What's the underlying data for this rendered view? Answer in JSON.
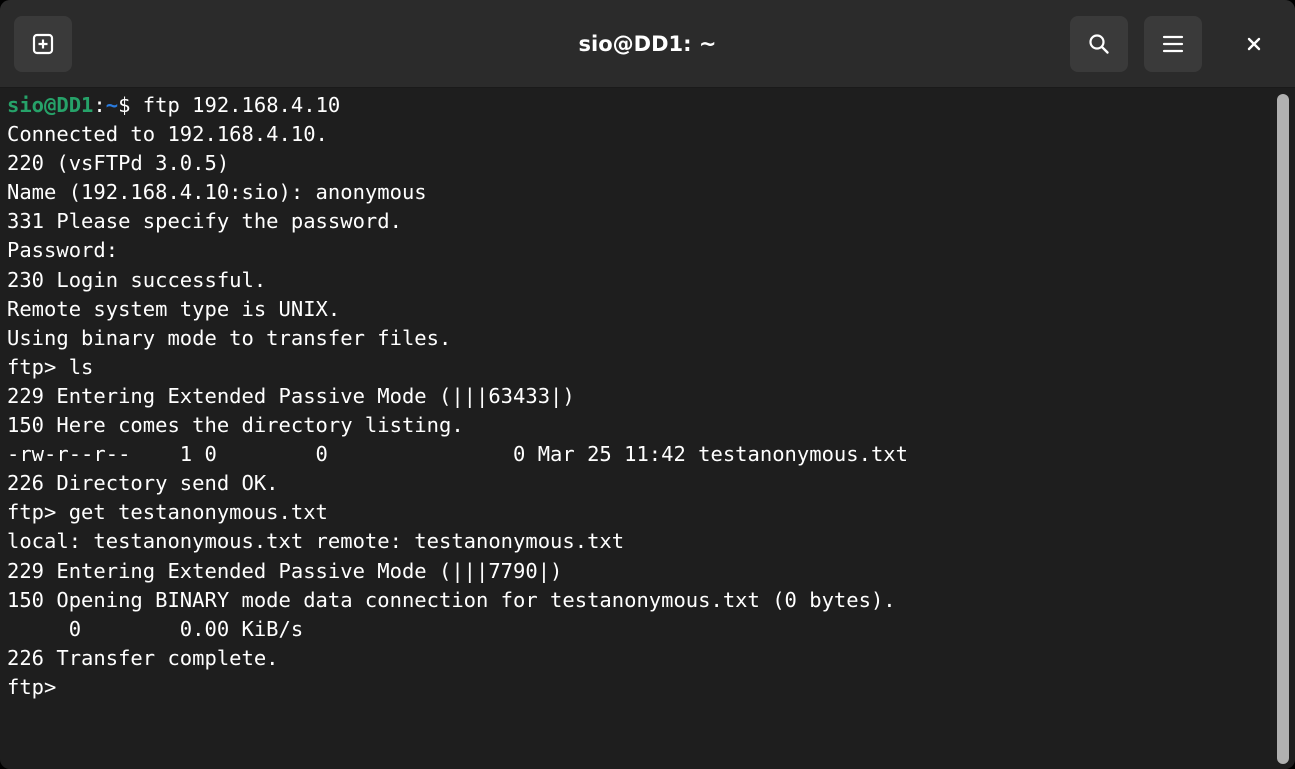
{
  "window": {
    "title": "sio@DD1: ~"
  },
  "icons": {
    "new_tab": "new-tab-icon",
    "search": "search-icon",
    "menu": "hamburger-menu-icon",
    "close": "close-icon"
  },
  "colors": {
    "background": "#1e1e1e",
    "titlebar": "#2b2b2b",
    "text": "#ffffff",
    "prompt_user": "#26a269",
    "prompt_path": "#2a7bde"
  },
  "terminal": {
    "prompt": {
      "user": "sio@DD1",
      "sep": ":",
      "path": "~",
      "symbol": "$ ",
      "command": "ftp 192.168.4.10"
    },
    "lines": [
      "Connected to 192.168.4.10.",
      "220 (vsFTPd 3.0.5)",
      "Name (192.168.4.10:sio): anonymous",
      "331 Please specify the password.",
      "Password:",
      "230 Login successful.",
      "Remote system type is UNIX.",
      "Using binary mode to transfer files.",
      "ftp> ls",
      "229 Entering Extended Passive Mode (|||63433|)",
      "150 Here comes the directory listing.",
      "-rw-r--r--    1 0        0               0 Mar 25 11:42 testanonymous.txt",
      "226 Directory send OK.",
      "ftp> get testanonymous.txt",
      "local: testanonymous.txt remote: testanonymous.txt",
      "229 Entering Extended Passive Mode (|||7790|)",
      "150 Opening BINARY mode data connection for testanonymous.txt (0 bytes).",
      "     0        0.00 KiB/s",
      "226 Transfer complete.",
      "ftp> "
    ]
  }
}
